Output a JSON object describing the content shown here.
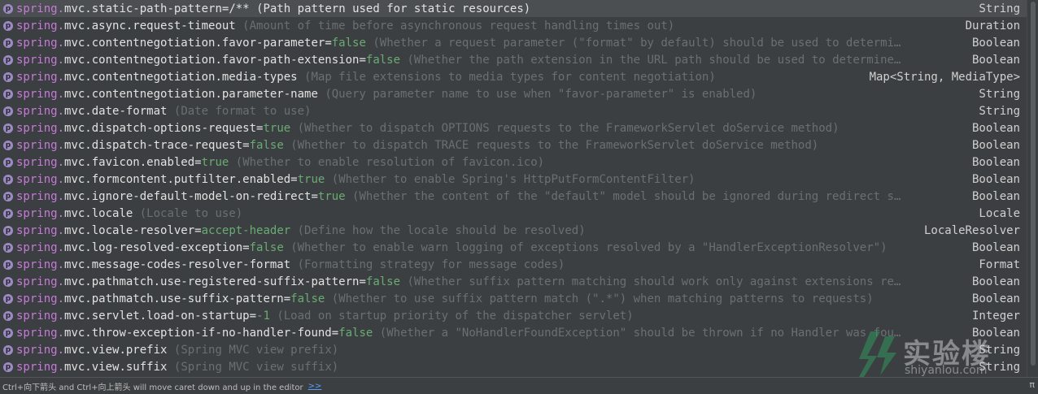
{
  "items": [
    {
      "prefix": "spring.",
      "key": "mvc.static-path-pattern",
      "value": "/**",
      "desc": "(Path pattern used for static resources)",
      "type": "String"
    },
    {
      "prefix": "spring.",
      "key": "mvc.async.request-timeout",
      "value": "",
      "desc": "(Amount of time before asynchronous request handling times out)",
      "type": "Duration"
    },
    {
      "prefix": "spring.",
      "key": "mvc.contentnegotiation.favor-parameter",
      "value": "false",
      "desc": "(Whether a request parameter (\"format\" by default) should be used to determi…",
      "type": "Boolean"
    },
    {
      "prefix": "spring.",
      "key": "mvc.contentnegotiation.favor-path-extension",
      "value": "false",
      "desc": "(Whether the path extension in the URL path should be used to determine…",
      "type": "Boolean"
    },
    {
      "prefix": "spring.",
      "key": "mvc.contentnegotiation.media-types",
      "value": "",
      "desc": "(Map file extensions to media types for content negotiation)",
      "type": "Map<String, MediaType>"
    },
    {
      "prefix": "spring.",
      "key": "mvc.contentnegotiation.parameter-name",
      "value": "",
      "desc": "(Query parameter name to use when \"favor-parameter\" is enabled)",
      "type": "String"
    },
    {
      "prefix": "spring.",
      "key": "mvc.date-format",
      "value": "",
      "desc": "(Date format to use)",
      "type": "String"
    },
    {
      "prefix": "spring.",
      "key": "mvc.dispatch-options-request",
      "value": "true",
      "desc": "(Whether to dispatch OPTIONS requests to the FrameworkServlet doService method)",
      "type": "Boolean"
    },
    {
      "prefix": "spring.",
      "key": "mvc.dispatch-trace-request",
      "value": "false",
      "desc": "(Whether to dispatch TRACE requests to the FrameworkServlet doService method)",
      "type": "Boolean"
    },
    {
      "prefix": "spring.",
      "key": "mvc.favicon.enabled",
      "value": "true",
      "desc": "(Whether to enable resolution of favicon.ico)",
      "type": "Boolean"
    },
    {
      "prefix": "spring.",
      "key": "mvc.formcontent.putfilter.enabled",
      "value": "true",
      "desc": "(Whether to enable Spring's HttpPutFormContentFilter)",
      "type": "Boolean"
    },
    {
      "prefix": "spring.",
      "key": "mvc.ignore-default-model-on-redirect",
      "value": "true",
      "desc": "(Whether the content of the \"default\" model should be ignored during redirect s…",
      "type": "Boolean"
    },
    {
      "prefix": "spring.",
      "key": "mvc.locale",
      "value": "",
      "desc": "(Locale to use)",
      "type": "Locale"
    },
    {
      "prefix": "spring.",
      "key": "mvc.locale-resolver",
      "value": "accept-header",
      "desc": "(Define how the locale should be resolved)",
      "type": "LocaleResolver"
    },
    {
      "prefix": "spring.",
      "key": "mvc.log-resolved-exception",
      "value": "false",
      "desc": "(Whether to enable warn logging of exceptions resolved by a \"HandlerExceptionResolver\")",
      "type": "Boolean"
    },
    {
      "prefix": "spring.",
      "key": "mvc.message-codes-resolver-format",
      "value": "",
      "desc": "(Formatting strategy for message codes)",
      "type": "Format"
    },
    {
      "prefix": "spring.",
      "key": "mvc.pathmatch.use-registered-suffix-pattern",
      "value": "false",
      "desc": "(Whether suffix pattern matching should work only against extensions re…",
      "type": "Boolean"
    },
    {
      "prefix": "spring.",
      "key": "mvc.pathmatch.use-suffix-pattern",
      "value": "false",
      "desc": "(Whether to use suffix pattern match (\".*\") when matching patterns to requests)",
      "type": "Boolean"
    },
    {
      "prefix": "spring.",
      "key": "mvc.servlet.load-on-startup",
      "value": "-1",
      "desc": "(Load on startup priority of the dispatcher servlet)",
      "type": "Integer"
    },
    {
      "prefix": "spring.",
      "key": "mvc.throw-exception-if-no-handler-found",
      "value": "false",
      "desc": "(Whether a \"NoHandlerFoundException\" should be thrown if no Handler was fou…",
      "type": "Boolean"
    },
    {
      "prefix": "spring.",
      "key": "mvc.view.prefix",
      "value": "",
      "desc": "(Spring MVC view prefix)",
      "type": "String"
    },
    {
      "prefix": "spring.",
      "key": "mvc.view.suffix",
      "value": "",
      "desc": "(Spring MVC view suffix)",
      "type": "String"
    }
  ],
  "icon_letter": "p",
  "footer": {
    "hint": "Ctrl+向下箭头 and Ctrl+向上箭头 will move caret down and up in the editor",
    "link": ">>",
    "pi": "π"
  },
  "watermark": {
    "title": "实验楼",
    "subtitle": "shiyanlou.com"
  },
  "colors": {
    "background": "#3c3f41",
    "selected_row": "#4b4f52",
    "key_prefix": "#c57bd6",
    "value": "#6aab73",
    "description": "#6b6f73",
    "link": "#589df6"
  },
  "selected_index": 0
}
